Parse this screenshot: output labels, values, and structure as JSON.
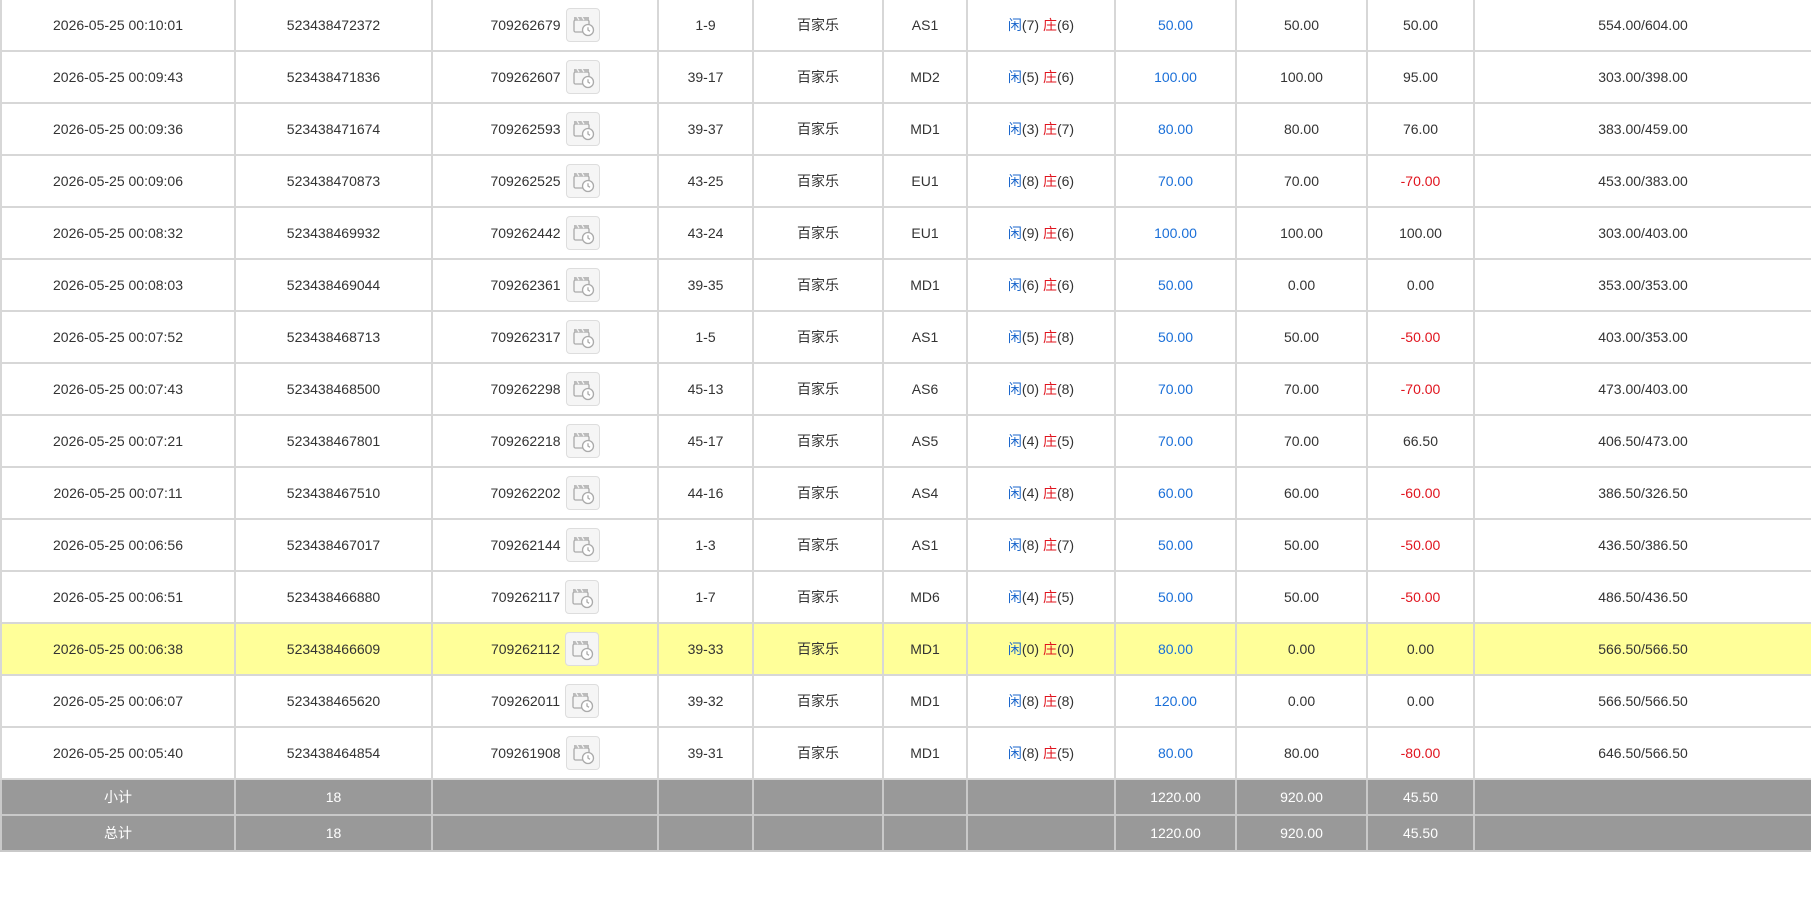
{
  "labels": {
    "player": "闲",
    "banker": "庄"
  },
  "rows": [
    {
      "time": "2026-05-25 00:10:01",
      "bet_id": "523438472372",
      "game_id": "709262679",
      "shoe": "1-9",
      "game": "百家乐",
      "table": "AS1",
      "player": "(7)",
      "banker": "(6)",
      "bet": "50.00",
      "valid": "50.00",
      "win": "50.00",
      "balance": "554.00/604.00"
    },
    {
      "time": "2026-05-25 00:09:43",
      "bet_id": "523438471836",
      "game_id": "709262607",
      "shoe": "39-17",
      "game": "百家乐",
      "table": "MD2",
      "player": "(5)",
      "banker": "(6)",
      "bet": "100.00",
      "valid": "100.00",
      "win": "95.00",
      "balance": "303.00/398.00"
    },
    {
      "time": "2026-05-25 00:09:36",
      "bet_id": "523438471674",
      "game_id": "709262593",
      "shoe": "39-37",
      "game": "百家乐",
      "table": "MD1",
      "player": "(3)",
      "banker": "(7)",
      "bet": "80.00",
      "valid": "80.00",
      "win": "76.00",
      "balance": "383.00/459.00"
    },
    {
      "time": "2026-05-25 00:09:06",
      "bet_id": "523438470873",
      "game_id": "709262525",
      "shoe": "43-25",
      "game": "百家乐",
      "table": "EU1",
      "player": "(8)",
      "banker": "(6)",
      "bet": "70.00",
      "valid": "70.00",
      "win": "-70.00",
      "balance": "453.00/383.00"
    },
    {
      "time": "2026-05-25 00:08:32",
      "bet_id": "523438469932",
      "game_id": "709262442",
      "shoe": "43-24",
      "game": "百家乐",
      "table": "EU1",
      "player": "(9)",
      "banker": "(6)",
      "bet": "100.00",
      "valid": "100.00",
      "win": "100.00",
      "balance": "303.00/403.00"
    },
    {
      "time": "2026-05-25 00:08:03",
      "bet_id": "523438469044",
      "game_id": "709262361",
      "shoe": "39-35",
      "game": "百家乐",
      "table": "MD1",
      "player": "(6)",
      "banker": "(6)",
      "bet": "50.00",
      "valid": "0.00",
      "win": "0.00",
      "balance": "353.00/353.00"
    },
    {
      "time": "2026-05-25 00:07:52",
      "bet_id": "523438468713",
      "game_id": "709262317",
      "shoe": "1-5",
      "game": "百家乐",
      "table": "AS1",
      "player": "(5)",
      "banker": "(8)",
      "bet": "50.00",
      "valid": "50.00",
      "win": "-50.00",
      "balance": "403.00/353.00"
    },
    {
      "time": "2026-05-25 00:07:43",
      "bet_id": "523438468500",
      "game_id": "709262298",
      "shoe": "45-13",
      "game": "百家乐",
      "table": "AS6",
      "player": "(0)",
      "banker": "(8)",
      "bet": "70.00",
      "valid": "70.00",
      "win": "-70.00",
      "balance": "473.00/403.00"
    },
    {
      "time": "2026-05-25 00:07:21",
      "bet_id": "523438467801",
      "game_id": "709262218",
      "shoe": "45-17",
      "game": "百家乐",
      "table": "AS5",
      "player": "(4)",
      "banker": "(5)",
      "bet": "70.00",
      "valid": "70.00",
      "win": "66.50",
      "balance": "406.50/473.00"
    },
    {
      "time": "2026-05-25 00:07:11",
      "bet_id": "523438467510",
      "game_id": "709262202",
      "shoe": "44-16",
      "game": "百家乐",
      "table": "AS4",
      "player": "(4)",
      "banker": "(8)",
      "bet": "60.00",
      "valid": "60.00",
      "win": "-60.00",
      "balance": "386.50/326.50"
    },
    {
      "time": "2026-05-25 00:06:56",
      "bet_id": "523438467017",
      "game_id": "709262144",
      "shoe": "1-3",
      "game": "百家乐",
      "table": "AS1",
      "player": "(8)",
      "banker": "(7)",
      "bet": "50.00",
      "valid": "50.00",
      "win": "-50.00",
      "balance": "436.50/386.50"
    },
    {
      "time": "2026-05-25 00:06:51",
      "bet_id": "523438466880",
      "game_id": "709262117",
      "shoe": "1-7",
      "game": "百家乐",
      "table": "MD6",
      "player": "(4)",
      "banker": "(5)",
      "bet": "50.00",
      "valid": "50.00",
      "win": "-50.00",
      "balance": "486.50/436.50"
    },
    {
      "time": "2026-05-25 00:06:38",
      "bet_id": "523438466609",
      "game_id": "709262112",
      "shoe": "39-33",
      "game": "百家乐",
      "table": "MD1",
      "player": "(0)",
      "banker": "(0)",
      "bet": "80.00",
      "valid": "0.00",
      "win": "0.00",
      "balance": "566.50/566.50",
      "highlight": true
    },
    {
      "time": "2026-05-25 00:06:07",
      "bet_id": "523438465620",
      "game_id": "709262011",
      "shoe": "39-32",
      "game": "百家乐",
      "table": "MD1",
      "player": "(8)",
      "banker": "(8)",
      "bet": "120.00",
      "valid": "0.00",
      "win": "0.00",
      "balance": "566.50/566.50"
    },
    {
      "time": "2026-05-25 00:05:40",
      "bet_id": "523438464854",
      "game_id": "709261908",
      "shoe": "39-31",
      "game": "百家乐",
      "table": "MD1",
      "player": "(8)",
      "banker": "(5)",
      "bet": "80.00",
      "valid": "80.00",
      "win": "-80.00",
      "balance": "646.50/566.50"
    }
  ],
  "subtotal": {
    "label": "小计",
    "count": "18",
    "bet": "1220.00",
    "valid": "920.00",
    "win": "45.50"
  },
  "total": {
    "label": "总计",
    "count": "18",
    "bet": "1220.00",
    "valid": "920.00",
    "win": "45.50"
  },
  "colors": {
    "player": "#1a66cc",
    "banker": "#e0141e",
    "bet_amount": "#1a6fd8",
    "loss": "#e0141e",
    "highlight_row": "#ffff99",
    "summary_row": "#999999"
  },
  "icons": {
    "replay": "video-replay-icon"
  }
}
